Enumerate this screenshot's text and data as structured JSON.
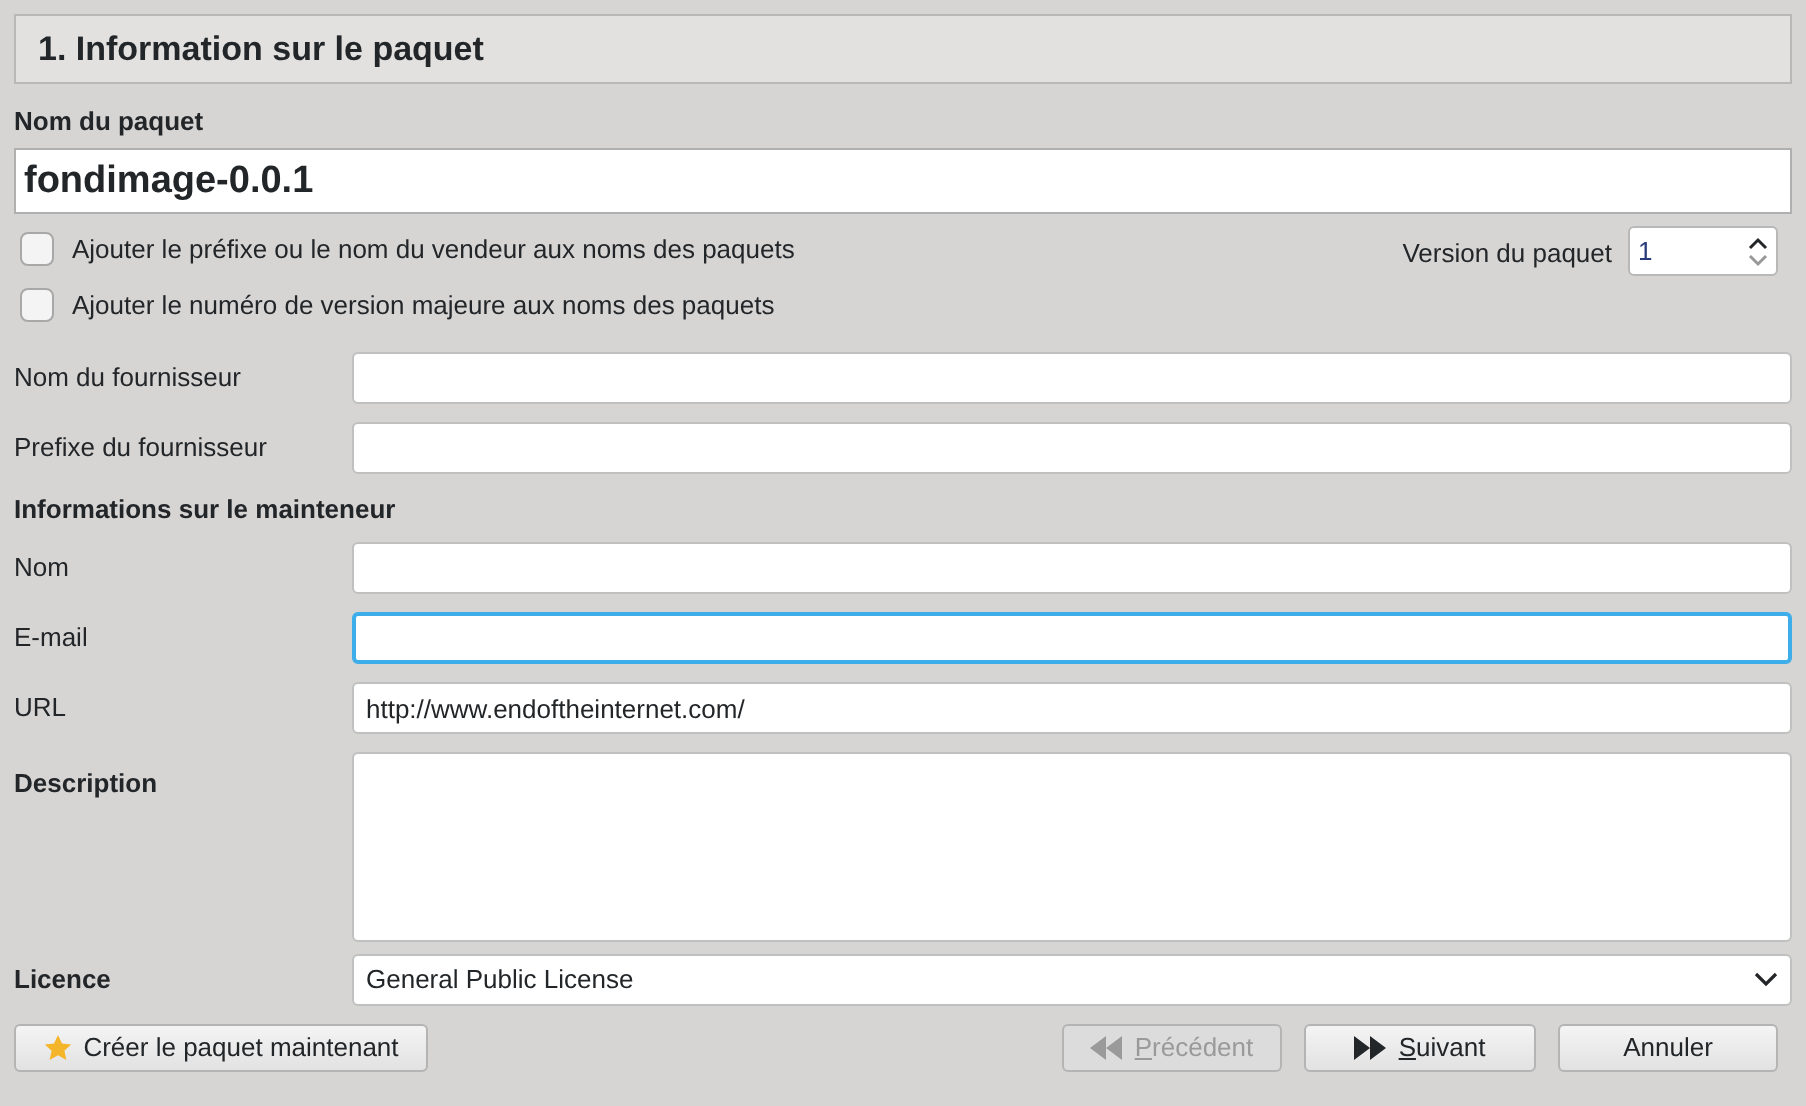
{
  "header": {
    "title": "1. Information sur le paquet"
  },
  "package_name": {
    "label": "Nom du paquet",
    "value": "fondimage-0.0.1"
  },
  "options": [
    {
      "label": "Ajouter le préfixe ou le nom du vendeur aux noms des paquets",
      "checked": false
    },
    {
      "label": "Ajouter le numéro de version majeure aux noms des paquets",
      "checked": false
    }
  ],
  "version": {
    "label": "Version du paquet",
    "value": "1"
  },
  "vendor_fields": [
    {
      "label": "Nom du fournisseur",
      "focused": false
    },
    {
      "label": "Prefixe du fournisseur",
      "focused": false
    }
  ],
  "maintainer": {
    "heading": "Informations sur le mainteneur",
    "fields": [
      {
        "label": "Nom",
        "focused": false
      },
      {
        "label": "E-mail",
        "focused": true
      },
      {
        "label": "URL",
        "value": "http://www.endoftheinternet.com/",
        "focused": false
      }
    ]
  },
  "description": {
    "label": "Description"
  },
  "licence": {
    "label": "Licence",
    "value": "General Public License"
  },
  "buttons": [
    {
      "kind": "star",
      "label": "Créer le paquet maintenant",
      "disabled": false,
      "underline_first": false
    },
    {
      "kind": "back",
      "label": "Précédent",
      "disabled": true,
      "underline_first": true
    },
    {
      "kind": "next",
      "label": "Suivant",
      "disabled": false,
      "underline_first": true
    },
    {
      "kind": "plain",
      "label": "Annuler",
      "disabled": false,
      "underline_first": false
    }
  ]
}
